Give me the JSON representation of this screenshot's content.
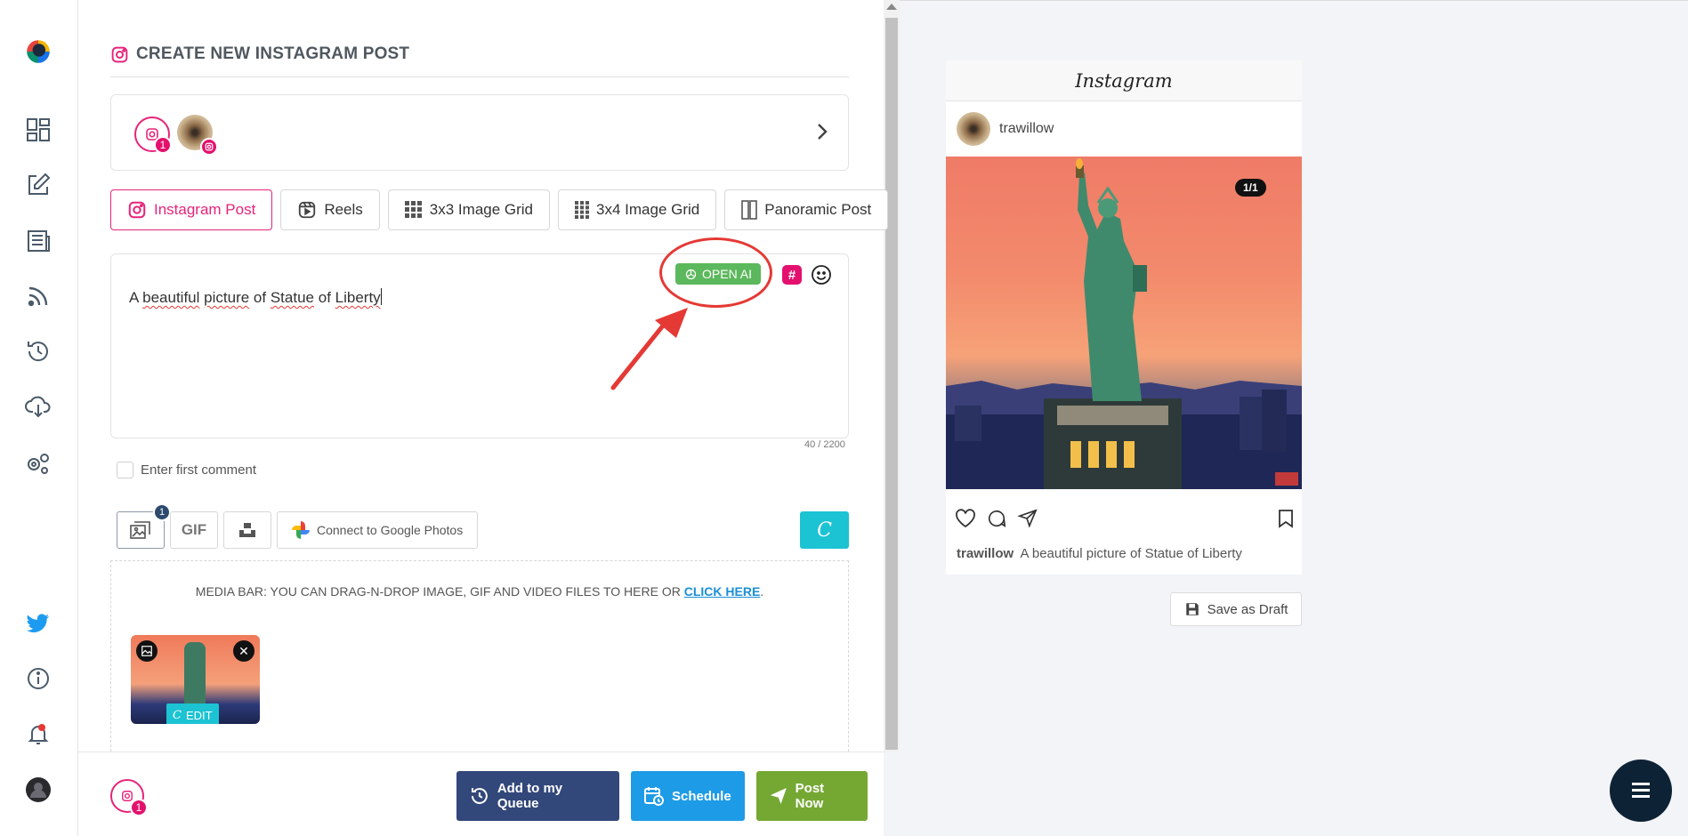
{
  "editor": {
    "title": "CREATE NEW INSTAGRAM POST",
    "account_badge": "1",
    "post_types": [
      "Instagram Post",
      "Reels",
      "3x3 Image Grid",
      "3x4 Image Grid",
      "Panoramic Post"
    ],
    "post_text_words": [
      "A",
      "beautiful",
      "picture",
      "of",
      "Statue",
      "of",
      "Liberty"
    ],
    "openai_label": "OPEN AI",
    "hashtag_symbol": "#",
    "char_count": "40 / 2200",
    "first_comment_label": "Enter first comment",
    "media_badge": "1",
    "gif_label": "GIF",
    "google_photos_label": "Connect to Google Photos",
    "media_bar_text": "MEDIA BAR: YOU CAN DRAG-N-DROP IMAGE, GIF AND VIDEO FILES TO HERE OR",
    "media_bar_link": "CLICK HERE",
    "media_bar_period": ".",
    "thumb_edit_label": "EDIT",
    "thumb_remove": "✕",
    "canva_letter": "C"
  },
  "footer": {
    "account_badge": "1",
    "queue_label": "Add to my Queue",
    "schedule_label": "Schedule",
    "post_label": "Post Now"
  },
  "preview": {
    "header": "Instagram",
    "username": "trawillow",
    "counter": "1/1",
    "caption_user": "trawillow",
    "caption_text": "A beautiful picture of Statue of Liberty",
    "save_draft_label": "Save as Draft"
  },
  "colors": {
    "brand_pink": "#e5247a",
    "openai_green": "#5cb85c",
    "queue_blue": "#32477a",
    "schedule_blue": "#1e9be6",
    "post_green": "#75a833",
    "canva_teal": "#1cc3d3",
    "annotation_red": "#e53935"
  }
}
